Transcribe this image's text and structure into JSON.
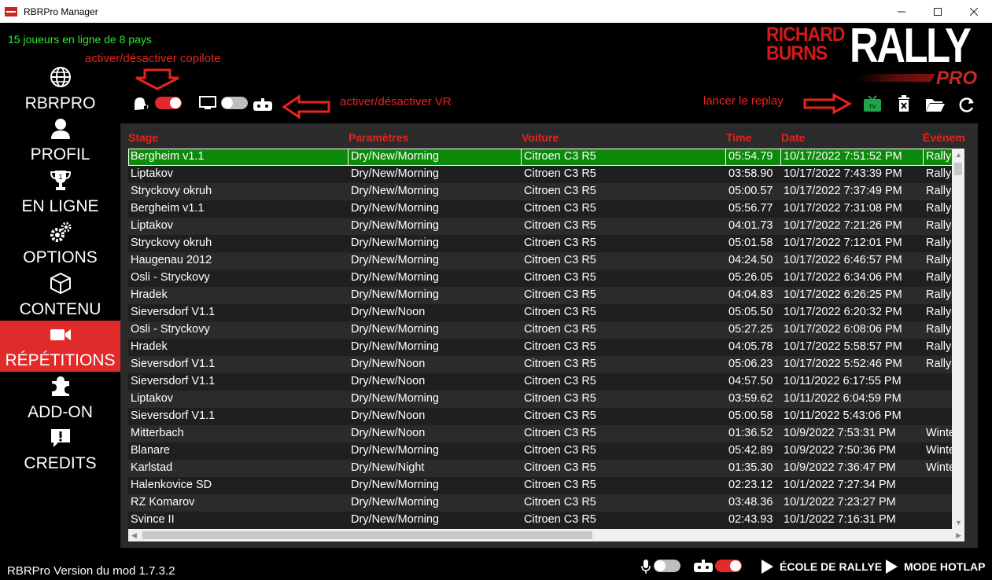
{
  "window": {
    "title": "RBRPro Manager",
    "minimize_icon": "minimize-icon",
    "maximize_icon": "maximize-icon",
    "close_icon": "close-icon"
  },
  "header": {
    "online_status": "15 joueurs en ligne de 8 pays",
    "logo_line1": "RICHARD",
    "logo_line2": "BURNS",
    "logo_rally": "RALLY",
    "logo_pro": "PRO"
  },
  "annotations": {
    "copilot": "activer/désactiver copilote",
    "vr": "activer/désactiver VR",
    "replay": "lancer le replay"
  },
  "sidebar": {
    "items": [
      {
        "label": "RBRPRO",
        "icon": "globe-icon"
      },
      {
        "label": "PROFIL",
        "icon": "user-icon"
      },
      {
        "label": "EN LIGNE",
        "icon": "trophy-icon"
      },
      {
        "label": "OPTIONS",
        "icon": "gears-icon"
      },
      {
        "label": "CONTENU",
        "icon": "box-icon"
      },
      {
        "label": "RÉPÉTITIONS",
        "icon": "video-camera-icon",
        "active": true
      },
      {
        "label": "ADD-ON",
        "icon": "puzzle-icon"
      },
      {
        "label": "CREDITS",
        "icon": "chat-info-icon"
      }
    ]
  },
  "toolbar": {
    "copilot_toggle_on": true,
    "vr_toggle_on": false,
    "accent_red": "#e12b2b",
    "accent_green": "#0b8a0b"
  },
  "table": {
    "headers": [
      "Stage",
      "Paramètres",
      "Voiture",
      "Time",
      "Date",
      "Événem"
    ],
    "rows": [
      [
        "Bergheim v1.1",
        "Dry/New/Morning",
        "Citroen C3 R5",
        "05:54.79",
        "10/17/2022 7:51:52 PM",
        "Rallye C"
      ],
      [
        "Liptakov",
        "Dry/New/Morning",
        "Citroen C3 R5",
        "03:58.90",
        "10/17/2022 7:43:39 PM",
        "Rallye C"
      ],
      [
        "Stryckovy okruh",
        "Dry/New/Morning",
        "Citroen C3 R5",
        "05:00.57",
        "10/17/2022 7:37:49 PM",
        "Rallye C"
      ],
      [
        "Bergheim v1.1",
        "Dry/New/Morning",
        "Citroen C3 R5",
        "05:56.77",
        "10/17/2022 7:31:08 PM",
        "Rallye C"
      ],
      [
        "Liptakov",
        "Dry/New/Morning",
        "Citroen C3 R5",
        "04:01.73",
        "10/17/2022 7:21:26 PM",
        "Rallye C"
      ],
      [
        "Stryckovy okruh",
        "Dry/New/Morning",
        "Citroen C3 R5",
        "05:01.58",
        "10/17/2022 7:12:01 PM",
        "Rallye C"
      ],
      [
        "Haugenau 2012",
        "Dry/New/Morning",
        "Citroen C3 R5",
        "04:24.50",
        "10/17/2022 6:46:57 PM",
        "Rallye C"
      ],
      [
        "Osli - Stryckovy",
        "Dry/New/Morning",
        "Citroen C3 R5",
        "05:26.05",
        "10/17/2022 6:34:06 PM",
        "Rallye C"
      ],
      [
        "Hradek",
        "Dry/New/Morning",
        "Citroen C3 R5",
        "04:04.83",
        "10/17/2022 6:26:25 PM",
        "Rallye C"
      ],
      [
        "Sieversdorf V1.1",
        "Dry/New/Noon",
        "Citroen C3 R5",
        "05:05.50",
        "10/17/2022 6:20:32 PM",
        "Rallye C"
      ],
      [
        "Osli - Stryckovy",
        "Dry/New/Morning",
        "Citroen C3 R5",
        "05:27.25",
        "10/17/2022 6:08:06 PM",
        "Rallye C"
      ],
      [
        "Hradek",
        "Dry/New/Morning",
        "Citroen C3 R5",
        "04:05.78",
        "10/17/2022 5:58:57 PM",
        "Rallye C"
      ],
      [
        "Sieversdorf V1.1",
        "Dry/New/Noon",
        "Citroen C3 R5",
        "05:06.23",
        "10/17/2022 5:52:46 PM",
        "Rallye C"
      ],
      [
        "Sieversdorf V1.1",
        "Dry/New/Noon",
        "Citroen C3 R5",
        "04:57.50",
        "10/11/2022 6:17:55 PM",
        ""
      ],
      [
        "Liptakov",
        "Dry/New/Morning",
        "Citroen C3 R5",
        "03:59.62",
        "10/11/2022 6:04:59 PM",
        ""
      ],
      [
        "Sieversdorf V1.1",
        "Dry/New/Noon",
        "Citroen C3 R5",
        "05:00.58",
        "10/11/2022 5:43:06 PM",
        ""
      ],
      [
        "Mitterbach",
        "Dry/New/Noon",
        "Citroen C3 R5",
        "01:36.52",
        "10/9/2022 7:53:31 PM",
        "Winter I"
      ],
      [
        "Blanare",
        "Dry/New/Morning",
        "Citroen C3 R5",
        "05:42.89",
        "10/9/2022 7:50:36 PM",
        "Winter I"
      ],
      [
        "Karlstad",
        "Dry/New/Night",
        "Citroen C3 R5",
        "01:35.30",
        "10/9/2022 7:36:47 PM",
        "Winter I"
      ],
      [
        "Halenkovice SD",
        "Dry/New/Morning",
        "Citroen C3 R5",
        "02:23.12",
        "10/1/2022 7:27:34 PM",
        ""
      ],
      [
        "RZ Komarov",
        "Dry/New/Morning",
        "Citroen C3 R5",
        "03:48.36",
        "10/1/2022 7:23:27 PM",
        ""
      ],
      [
        "Svince II",
        "Dry/New/Morning",
        "Citroen C3 R5",
        "02:43.93",
        "10/1/2022 7:16:31 PM",
        ""
      ]
    ],
    "selected_row": 0
  },
  "footer": {
    "version": "RBRPro Version du mod 1.7.3.2",
    "mic_toggle_on": false,
    "vr_toggle_on": true,
    "school_label": "ÉCOLE DE RALLYE",
    "hotlap_label": "MODE HOTLAP"
  }
}
